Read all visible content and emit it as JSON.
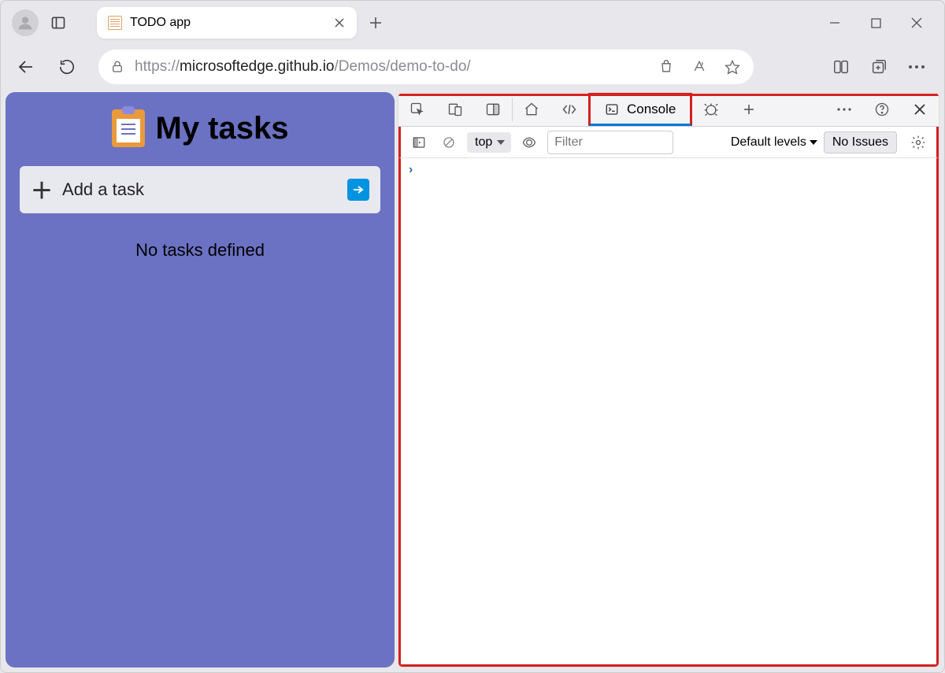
{
  "browser": {
    "tab": {
      "title": "TODO app"
    },
    "url_protocol": "https://",
    "url_host": "microsoftedge.github.io",
    "url_path": "/Demos/demo-to-do/"
  },
  "page": {
    "title": "My tasks",
    "add_task_placeholder": "Add a task",
    "empty_message": "No tasks defined"
  },
  "devtools": {
    "tabs": {
      "console": "Console"
    },
    "toolbar": {
      "context": "top",
      "filter_placeholder": "Filter",
      "levels": "Default levels",
      "issues": "No Issues"
    },
    "prompt": "›"
  }
}
